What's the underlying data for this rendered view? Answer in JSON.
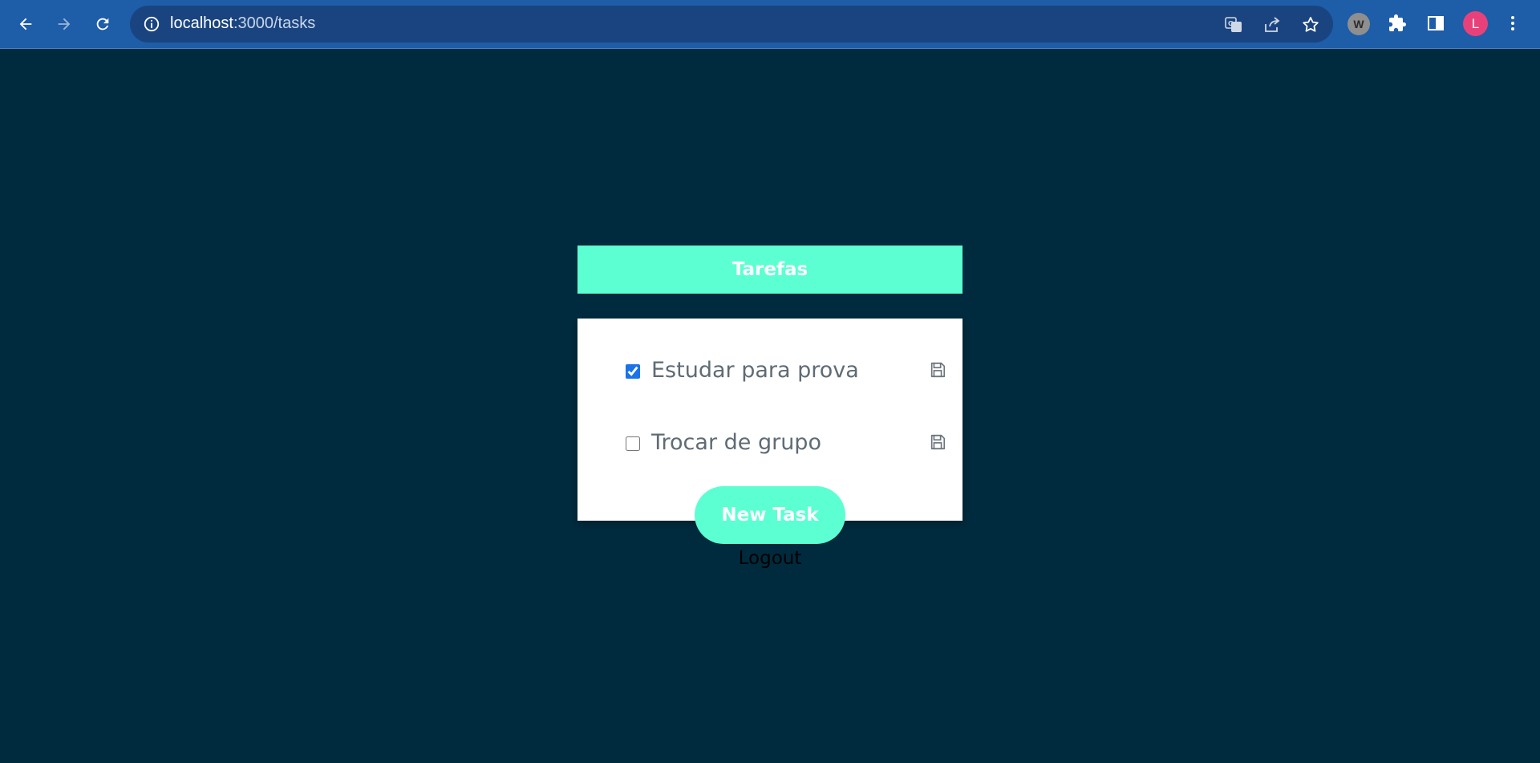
{
  "browser": {
    "url_host": "localhost",
    "url_path": ":3000/tasks",
    "avatar_letter": "L",
    "extension_letter": "W",
    "icons": [
      "back-icon",
      "forward-icon",
      "reload-icon",
      "info-icon",
      "translate-icon",
      "share-icon",
      "star-icon",
      "extension-icon",
      "puzzle-icon",
      "side-panel-icon",
      "avatar",
      "menu-icon"
    ]
  },
  "page": {
    "title": "Tarefas",
    "tasks": [
      {
        "label": "Estudar para prova",
        "checked": true
      },
      {
        "label": "Trocar de grupo",
        "checked": false
      }
    ],
    "new_task_label": "New Task",
    "logout_label": "Logout"
  },
  "colors": {
    "background": "#002b3e",
    "accent": "#5cffd1",
    "chrome": "#1e5da8",
    "task_text": "#5f6b75"
  }
}
